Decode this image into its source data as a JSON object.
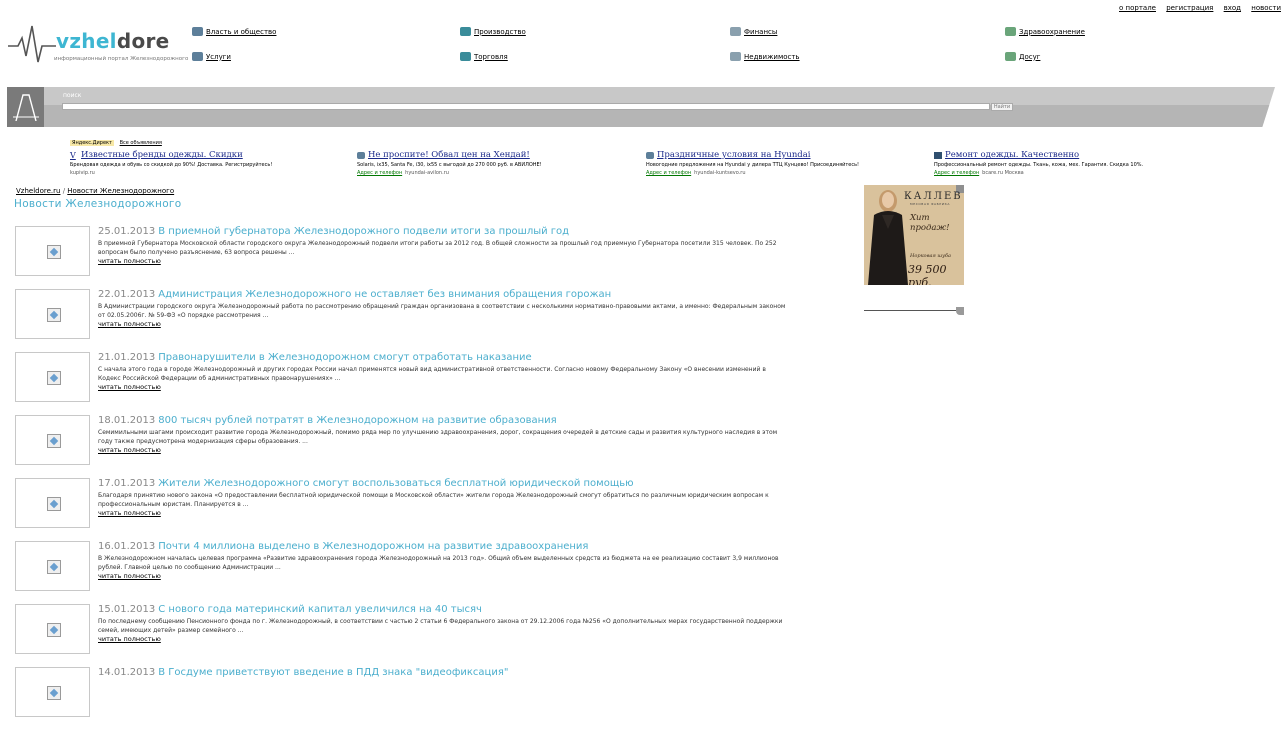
{
  "top_links": [
    "о портале",
    "регистрация",
    "вход",
    "новости"
  ],
  "logo": {
    "word_part1": "vzhel",
    "word_part2": "dore",
    "tagline": "информационный портал Железнодорожного",
    "icon": "heartbeat-icon"
  },
  "categories": [
    {
      "label": "Власть и общество",
      "icon": "building-icon"
    },
    {
      "label": "Производство",
      "icon": "factory-icon"
    },
    {
      "label": "Финансы",
      "icon": "coins-icon"
    },
    {
      "label": "Здравоохранение",
      "icon": "medical-icon"
    },
    {
      "label": "Услуги",
      "icon": "services-icon"
    },
    {
      "label": "Торговля",
      "icon": "shopping-bag-icon"
    },
    {
      "label": "Недвижимость",
      "icon": "house-icon"
    },
    {
      "label": "Досуг",
      "icon": "leisure-icon"
    }
  ],
  "search": {
    "label": "поиск",
    "placeholder": "",
    "button": "Найти"
  },
  "direct": {
    "badge": "Яндекс.Директ",
    "all_ads": "Все объявления"
  },
  "ads": [
    {
      "title": "Известные бренды одежды. Скидки",
      "desc": "Брендовая одежда и обувь со скидкой до 90%! Доставка. Регистрируйтесь!",
      "address": "",
      "url": "kupivip.ru",
      "favicon": "v-favicon-icon"
    },
    {
      "title": "Не проспите! Обвал цен на Хендай!",
      "desc": "Solaris, ix35, Santa Fe, i30, ix55 с выгодой до 270 000 руб. в АВИЛОНЕ!",
      "address": "Адрес и телефон",
      "url": "hyundai-avilon.ru",
      "favicon": "car-favicon-icon"
    },
    {
      "title": "Праздничные условия на Hyundai",
      "desc": "Новогодние предложения на Hyundai у дилера ТТЦ Кунцево! Присоединяйтесь!",
      "address": "Адрес и телефон",
      "url": "hyundai-kuntsevo.ru",
      "favicon": "car-favicon-icon"
    },
    {
      "title": "Ремонт одежды. Качественно",
      "desc": "Профессиональный ремонт одежды. Ткань, кожа, мех. Гарантия. Скидка 10%.",
      "address": "Адрес и телефон",
      "url": "bcare.ru",
      "url_suffix": "Москва",
      "favicon": "shirt-favicon-icon"
    }
  ],
  "breadcrumb": {
    "home": "Vzheldore.ru",
    "sep": "/",
    "current": "Новости Железнодорожного"
  },
  "page_title": "Новости Железнодорожного",
  "read_more": "читать полностью",
  "news": [
    {
      "date": "25.01.2013",
      "title": "В приемной губернатора Железнодорожного подвели итоги за прошлый год",
      "desc": "В приемной Губернатора Московской области городского округа Железнодорожный подвели итоги работы за 2012 год. В общей сложности за прошлый год приемную Губернатора посетили 315 человек. По 252 вопросам было получено разъяснение, 63 вопроса решены ..."
    },
    {
      "date": "22.01.2013",
      "title": "Администрация Железнодорожного не оставляет без внимания обращения горожан",
      "desc": "В Администрации городского округа Железнодорожный работа по рассмотрению обращений граждан организована в соответствии с несколькими нормативно-правовыми актами, а именно: Федеральным законом от 02.05.2006г. № 59-ФЗ «О порядке рассмотрения ..."
    },
    {
      "date": "21.01.2013",
      "title": "Правонарушители в Железнодорожном смогут отработать наказание",
      "desc": "С начала этого года в городе Железнодорожный и других городах России начал применятся новый вид административной ответственности. Согласно новому Федеральному Закону «О внесении изменений в Кодекс Российской Федерации об административных правонарушениях» ..."
    },
    {
      "date": "18.01.2013",
      "title": "800 тысяч рублей потратят в Железнодорожном на развитие образования",
      "desc": "Семимильными шагами происходит развитие города Железнодорожный, помимо ряда мер по улучшению здравоохранения, дорог, сокращения очередей в детские сады и развития культурного наследия в этом году также предусмотрена модернизация сферы образования. ..."
    },
    {
      "date": "17.01.2013",
      "title": "Жители Железнодорожного смогут воспользоваться бесплатной юридической помощью",
      "desc": " Благодаря принятию нового закона «О предоставлении бесплатной юридической помощи в Московской области» жители города Железнодорожный смогут обратиться по различным юридическим вопросам к профессиональным юристам. Планируется в ..."
    },
    {
      "date": "16.01.2013",
      "title": "Почти 4 миллиона выделено в Железнодорожном на развитие здравоохранения",
      "desc": "В Железнодорожном началась целевая программа «Развитие здравоохранения города Железнодорожный на 2013 год». Общий объем выделенных средств из бюджета на ее реализацию составит 3,9 миллионов рублей. Главной целью по сообщению Администрации ..."
    },
    {
      "date": "15.01.2013",
      "title": "С нового года материнский капитал увеличился на 40 тысяч",
      "desc": "По последнему сообщению Пенсионного фонда по г. Железнодорожный, в соответствии с частью 2 статьи 6 Федерального закона от 29.12.2006 года №256 «О дополнительных мерах государственной поддержки семей, имеющих детей» размер семейного ..."
    },
    {
      "date": "14.01.2013",
      "title": "В Госдуме приветствуют введение в ПДД знака \"видеофиксация\"",
      "desc": ""
    }
  ],
  "banner": {
    "brand": "КАЛЛЕВ",
    "sub": "МЕХОВАЯ ФАБРИКА",
    "hit": "Хит продаж!",
    "item": "Норковая шуба",
    "price": "39 500 руб."
  },
  "colors": {
    "accent": "#4baecd",
    "search_bar": "#c8c8c8",
    "ad_title": "#1b2a8a"
  }
}
